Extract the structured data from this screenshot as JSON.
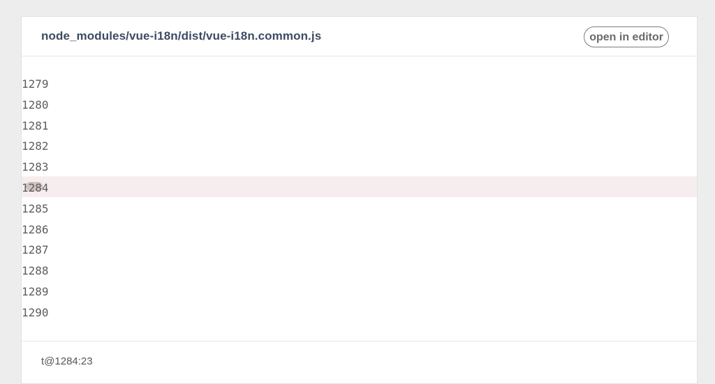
{
  "header": {
    "filename": "node_modules/vue-i18n/dist/vue-i18n.common.js",
    "open_label": "open in editor"
  },
  "code": {
    "highlight_line": "1284",
    "lines": [
      {
        "num": "1279"
      },
      {
        "num": "1280"
      },
      {
        "num": "1281"
      },
      {
        "num": "1282"
      },
      {
        "num": "1283"
      },
      {
        "num": "1284"
      },
      {
        "num": "1285"
      },
      {
        "num": "1286"
      },
      {
        "num": "1287"
      },
      {
        "num": "1288"
      },
      {
        "num": "1289"
      },
      {
        "num": "1290"
      }
    ]
  },
  "footer": {
    "location": "t@1284:23"
  }
}
